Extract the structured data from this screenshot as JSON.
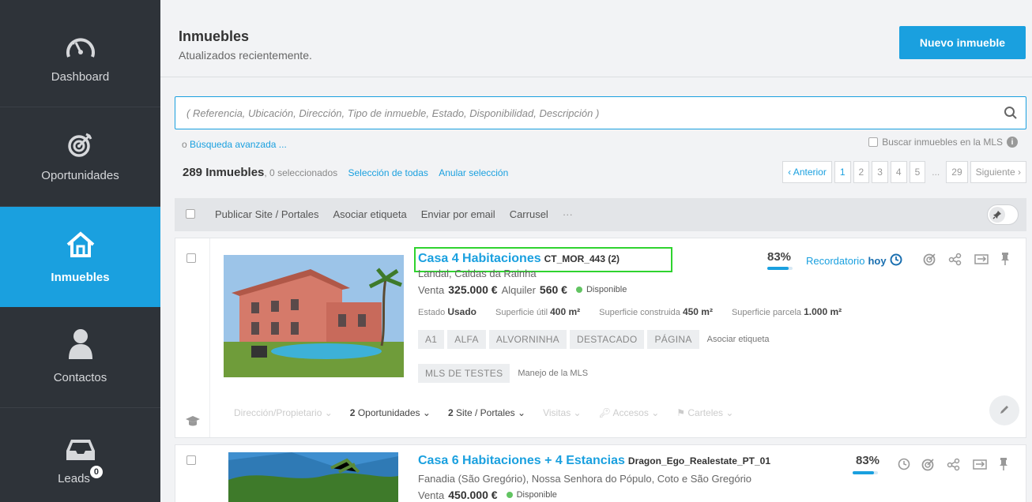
{
  "sidebar": {
    "items": [
      {
        "label": "Dashboard",
        "icon": "gauge-icon"
      },
      {
        "label": "Oportunidades",
        "icon": "target-icon"
      },
      {
        "label": "Inmuebles",
        "icon": "house-icon"
      },
      {
        "label": "Contactos",
        "icon": "person-icon"
      },
      {
        "label": "Leads",
        "icon": "inbox-icon",
        "badge": "0"
      }
    ]
  },
  "header": {
    "title": "Inmuebles",
    "subtitle": "Atualizados recientemente.",
    "new_button": "Nuevo inmueble"
  },
  "search": {
    "placeholder": "( Referencia, Ubicación, Dirección, Tipo de inmueble, Estado, Disponibilidad, Descripción )",
    "advanced_prefix": "o",
    "advanced_link": "Búsqueda avanzada ...",
    "mls_label": "Buscar inmuebles en la MLS"
  },
  "summary": {
    "count": "289 Inmuebles",
    "selected": ", 0 seleccionados",
    "select_all": "Selección de todas",
    "clear": "Anular selección"
  },
  "pager": {
    "prev": "‹ Anterior",
    "pages": [
      "1",
      "2",
      "3",
      "4",
      "5"
    ],
    "dots": "...",
    "last": "29",
    "next": "Siguiente ›"
  },
  "toolbar": {
    "items": [
      "Publicar Site / Portales",
      "Asociar etiqueta",
      "Enviar por email",
      "Carrusel",
      "···"
    ]
  },
  "listings": [
    {
      "title": "Casa 4 Habitaciones",
      "ref": "CT_MOR_443 (2)",
      "location": "Landal, Caldas da Rainha",
      "sale_label": "Venta",
      "sale_price": "325.000 €",
      "rent_label": "Alquiler",
      "rent_price": "560 €",
      "status": "Disponible",
      "state_label": "Estado",
      "state_value": "Usado",
      "useful_label": "Superficie útil",
      "useful_value": "400 m²",
      "built_label": "Superficie construida",
      "built_value": "450 m²",
      "plot_label": "Superficie parcela",
      "plot_value": "1.000 m²",
      "tags": [
        "A1",
        "ALFA",
        "ALVORNINHA",
        "DESTACADO",
        "PÁGINA"
      ],
      "tag_link": "Asociar etiqueta",
      "mls_tag": "MLS DE TESTES",
      "mls_link": "Manejo de la MLS",
      "percent": "83%",
      "percent_value": 0.83,
      "reminder_label": "Recordatorio",
      "reminder_value": "hoy",
      "footer": {
        "owner": "Dirección/Propietario",
        "opps_num": "2",
        "opps": "Oportunidades",
        "portals_num": "2",
        "portals": "Site / Portales",
        "visits": "Visitas",
        "access": "Accesos",
        "signs": "Carteles"
      }
    },
    {
      "title": "Casa 6 Habitaciones + 4 Estancias",
      "ref": "Dragon_Ego_Realestate_PT_01",
      "location": "Fanadia (São Gregório), Nossa Senhora do Pópulo, Coto e São Gregório",
      "sale_label": "Venta",
      "sale_price": "450.000 €",
      "status": "Disponible",
      "percent": "83%",
      "percent_value": 0.83
    }
  ],
  "colors": {
    "accent": "#1aa0df",
    "sidebar": "#2e3339",
    "available": "#62c462",
    "highlight": "#2fd32f"
  }
}
